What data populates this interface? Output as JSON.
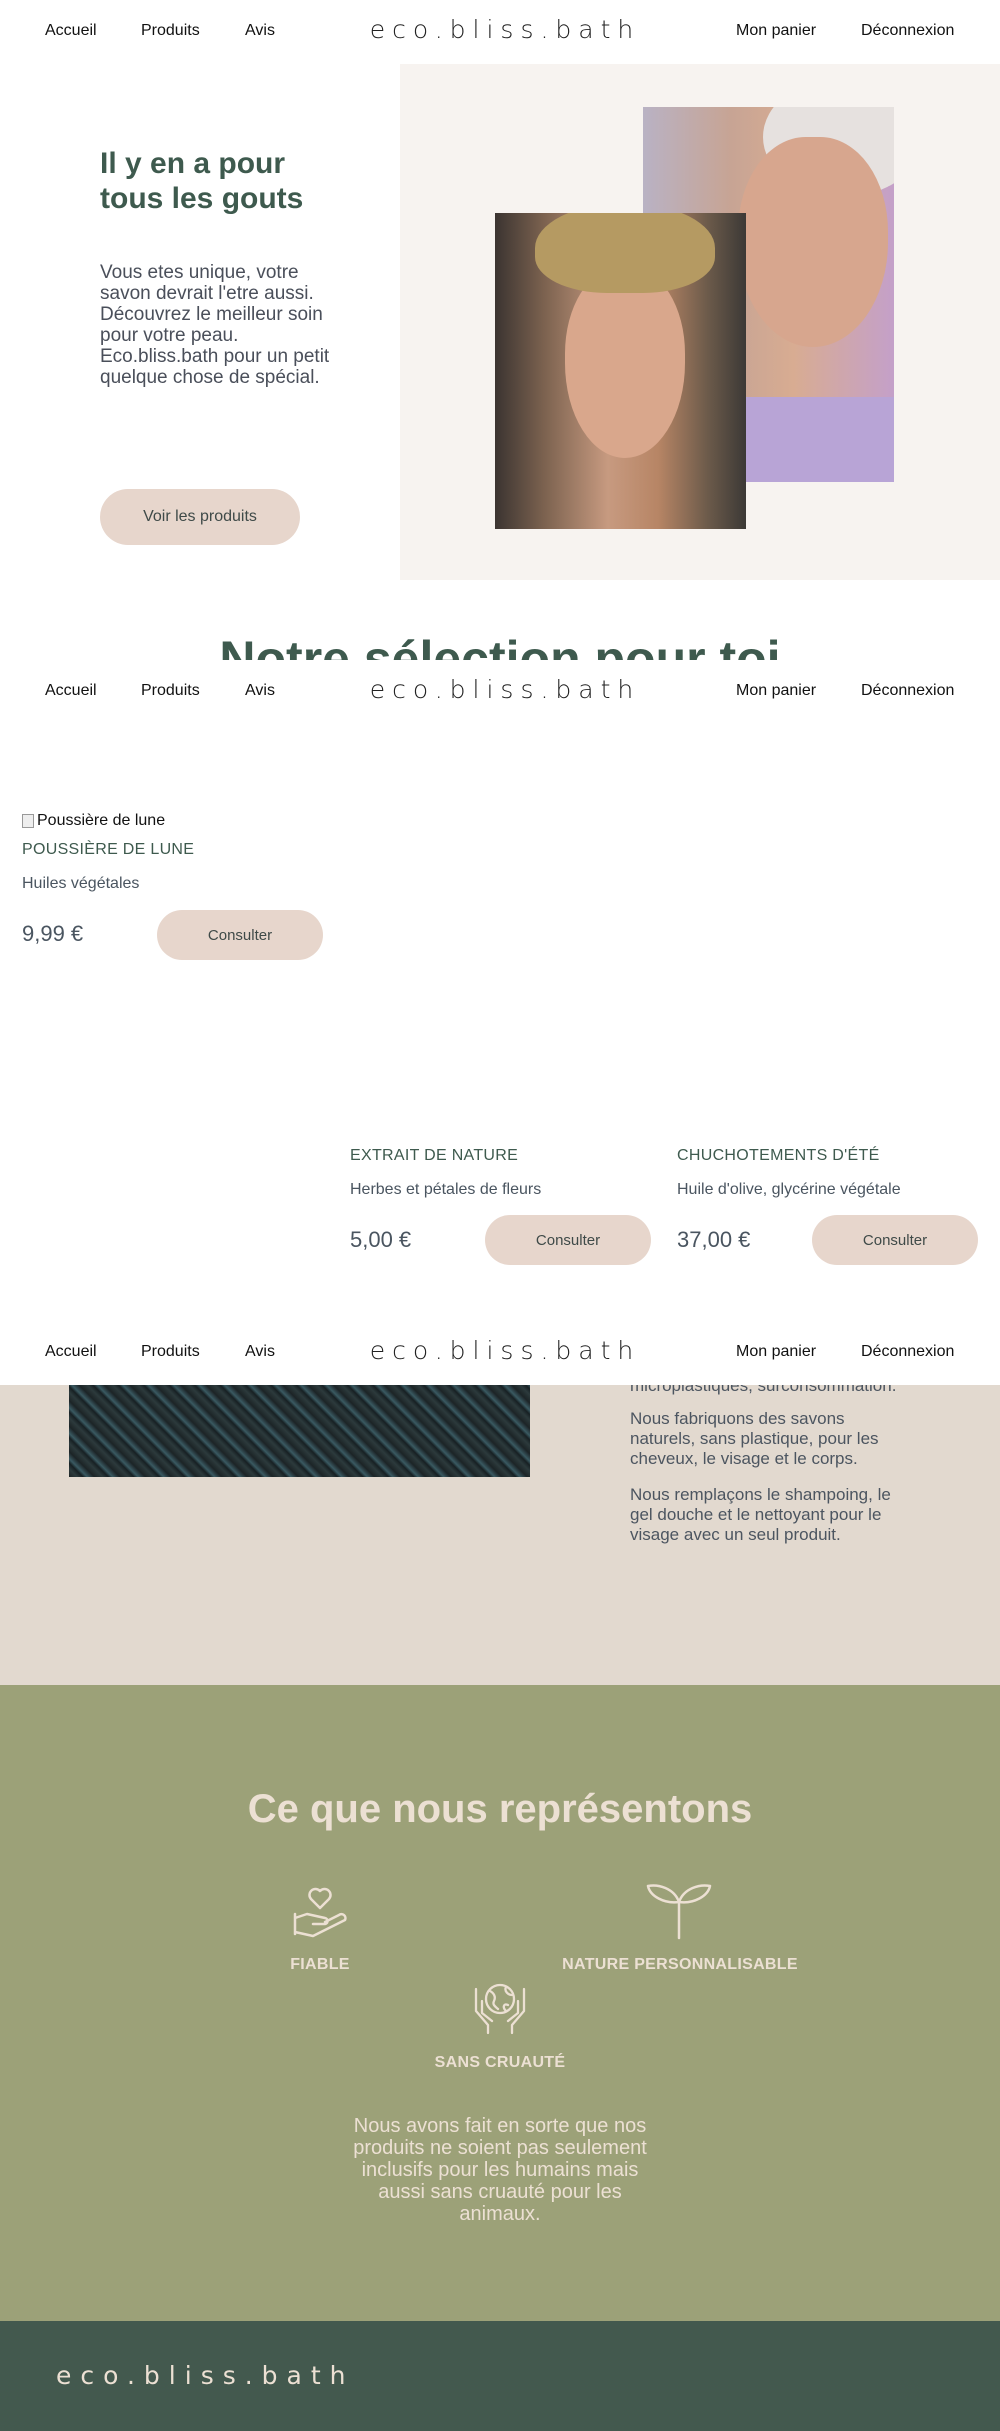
{
  "nav": {
    "home": "Accueil",
    "products": "Produits",
    "reviews": "Avis",
    "brand": "eco.bliss.bath",
    "cart": "Mon panier",
    "logout": "Déconnexion"
  },
  "hero": {
    "title": "Il y en a pour tous les gouts",
    "text": "Vous etes unique, votre savon devrait l'etre aussi. Découvrez le meilleur soin pour votre peau. Eco.bliss.bath pour un petit quelque chose de spécial.",
    "button": "Voir les produits"
  },
  "selection": {
    "title": "Notre sélection pour toi"
  },
  "products": [
    {
      "img_alt": "Poussière de lune",
      "name": "POUSSIÈRE DE LUNE",
      "desc": "Huiles végétales",
      "price": "9,99 €",
      "button": "Consulter"
    },
    {
      "name": "EXTRAIT DE NATURE",
      "desc": "Herbes et pétales de fleurs",
      "price": "5,00 €",
      "button": "Consulter"
    },
    {
      "name": "CHUCHOTEMENTS D'ÉTÉ",
      "desc": "Huile d'olive, glycérine végétale",
      "price": "37,00 €",
      "button": "Consulter"
    }
  ],
  "about": {
    "partial": "microplastiques, surconsommation.",
    "p1": "Nous fabriquons des savons naturels, sans plastique, pour les cheveux, le visage et le corps.",
    "p2": "Nous remplaçons le shampoing, le gel douche et le nettoyant pour le visage avec un seul produit."
  },
  "values": {
    "title": "Ce que nous représentons",
    "items": [
      {
        "label": "FIABLE",
        "icon": "heart-hand-icon"
      },
      {
        "label": "NATURE PERSONNALISABLE",
        "icon": "sprout-icon"
      },
      {
        "label": "SANS CRUAUTÉ",
        "icon": "globe-hands-icon"
      }
    ],
    "text": "Nous avons fait en sorte que nos produits ne soient pas seulement inclusifs pour les humains mais aussi sans cruauté pour les animaux."
  },
  "footer": {
    "brand": "eco.bliss.bath"
  },
  "colors": {
    "primary": "#3e5a4e",
    "button": "#e7d6cc",
    "values_bg": "#9ca178",
    "footer_bg": "#43594e",
    "cream": "#ece0d3"
  }
}
